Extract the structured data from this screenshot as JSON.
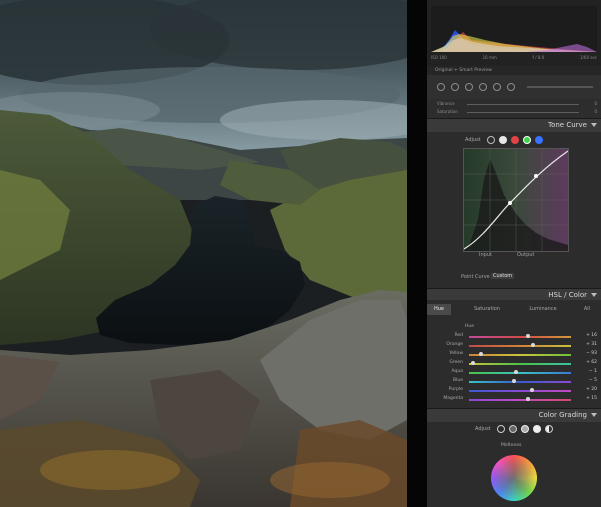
{
  "histogram": {
    "iso": "ISO 100",
    "focal": "16 mm",
    "aperture": "f / 8.0",
    "shutter": "1/60 sec"
  },
  "preview": {
    "label": "Original + Smart Preview"
  },
  "basic_rows": [
    {
      "label": "Vibrance",
      "value": "0"
    },
    {
      "label": "Saturation",
      "value": "0"
    }
  ],
  "tone_curve": {
    "title": "Tone Curve",
    "adjust_label": "Adjust",
    "input_label": "Input",
    "output_label": "Output",
    "point_curve_label": "Point Curve",
    "point_curve_value": "Custom"
  },
  "hsl": {
    "title": "HSL / Color",
    "tabs": [
      "Hue",
      "Saturation",
      "Luminance",
      "All"
    ],
    "active_tab": "Hue",
    "group_label": "Hue",
    "rows": [
      {
        "label": "Red",
        "value": "+ 16",
        "level": 0.58
      },
      {
        "label": "Orange",
        "value": "+ 31",
        "level": 0.63
      },
      {
        "label": "Yellow",
        "value": "− 93",
        "level": 0.12
      },
      {
        "label": "Green",
        "value": "+ 62",
        "level": 0.04
      },
      {
        "label": "Aqua",
        "value": "− 1",
        "level": 0.46
      },
      {
        "label": "Blue",
        "value": "− 5",
        "level": 0.44
      },
      {
        "label": "Purple",
        "value": "+ 20",
        "level": 0.62
      },
      {
        "label": "Magenta",
        "value": "+ 15",
        "level": 0.58
      }
    ]
  },
  "color_grading": {
    "title": "Color Grading",
    "adjust_label": "Adjust",
    "wheel_label": "Midtones"
  },
  "colors": {
    "panel_bg": "#2c2c2c",
    "section_header": "#3a3a3a",
    "curve_line": "#e6e6e6"
  }
}
